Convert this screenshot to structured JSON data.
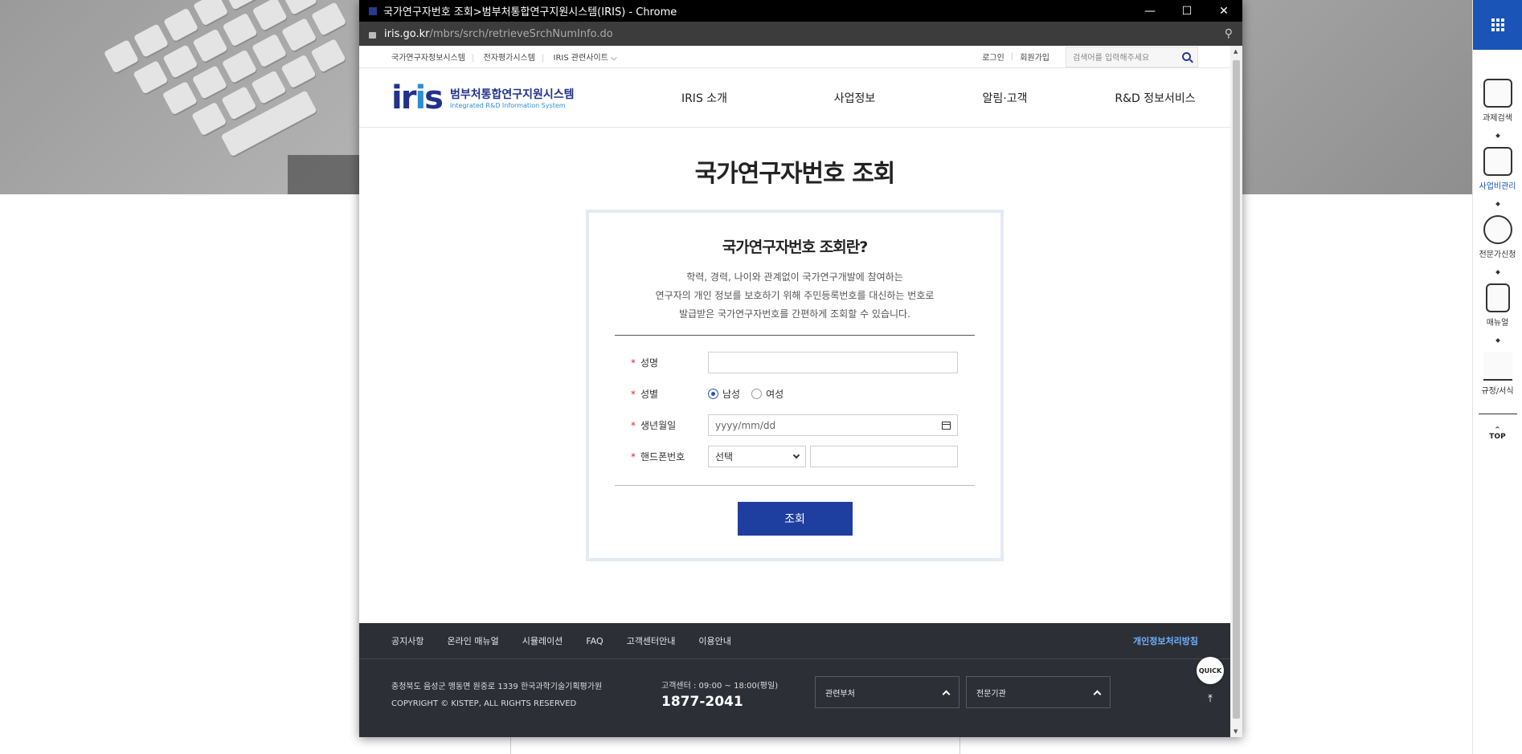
{
  "window": {
    "title": "국가연구자번호 조회>범부처통합연구지원시스템(IRIS) - Chrome",
    "controls": {
      "minimize": "—",
      "maximize": "☐",
      "close": "✕"
    }
  },
  "address": {
    "domain": "iris.go.kr",
    "path": "/mbrs/srch/retrieveSrchNumInfo.do"
  },
  "util": {
    "links": [
      "국가연구자정보시스템",
      "전자평가시스템",
      "IRIS 관련사이트 ⌵"
    ],
    "login": "로그인",
    "join": "회원가입",
    "search_placeholder": "검색어를 입력해주세요"
  },
  "logo": {
    "mark_a": "ir",
    "mark_b": "i",
    "mark_c": "s",
    "kor": "범부처통합연구지원시스템",
    "eng": "Integrated R&D Information System"
  },
  "menu": [
    "IRIS 소개",
    "사업정보",
    "알림·고객",
    "R&D 정보서비스"
  ],
  "main": {
    "title": "국가연구자번호 조회",
    "box_title": "국가연구자번호 조회란?",
    "desc": [
      "학력, 경력, 나이와 관계없이 국가연구개발에 참여하는",
      "연구자의 개인 정보를 보호하기 위해 주민등록번호를 대신하는 번호로",
      "발급받은 국가연구자번호를 간편하게 조회할 수 있습니다."
    ],
    "form": {
      "required_mark": "*",
      "name_label": "성명",
      "gender_label": "성별",
      "gender_male": "남성",
      "gender_female": "여성",
      "birth_label": "생년월일",
      "birth_placeholder": "yyyy/mm/dd",
      "phone_label": "핸드폰번호",
      "phone_select": "선택"
    },
    "submit": "조회"
  },
  "footer": {
    "nav": [
      "공지사항",
      "온라인 매뉴얼",
      "시뮬레이션",
      "FAQ",
      "고객센터안내",
      "이용안내"
    ],
    "privacy": "개인정보처리방침",
    "address": "충청북도 음성군 맹동면 원중로 1339 한국과학기술기획평가원",
    "copyright": "COPYRIGHT © KISTEP, ALL RIGHTS RESERVED",
    "cs_label": "고객센터 : 09:00 ~ 18:00(평일)",
    "cs_tel": "1877-2041",
    "select_dept": "관련부처",
    "select_org": "전문기관",
    "quick": "QUICK",
    "to_top": "⤒"
  },
  "rail": {
    "items": [
      "과제검색",
      "사업비관리",
      "전문가신청",
      "매뉴얼",
      "규정/서식"
    ],
    "active_index": 1,
    "top": "TOP"
  },
  "colors": {
    "brand": "#21328a",
    "accent": "#1e3ea0",
    "rail_top": "#1a54b7",
    "footer_bg": "#2d2f36",
    "required": "#e2262b"
  }
}
